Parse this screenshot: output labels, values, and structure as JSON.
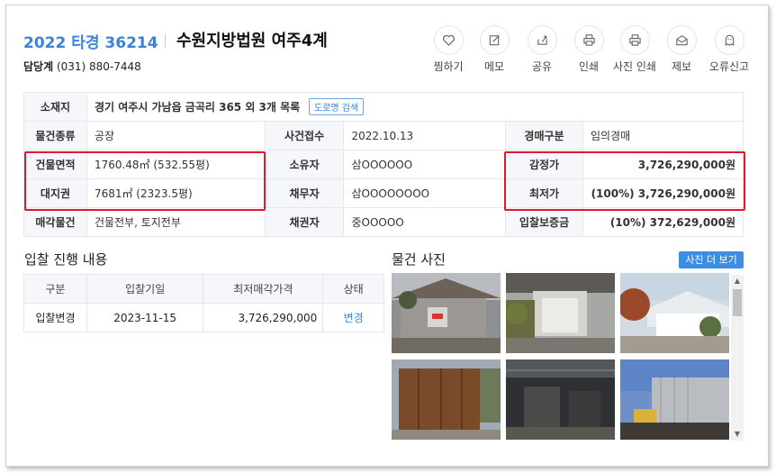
{
  "header": {
    "case_number": "2022 타경 36214",
    "court": "수원지방법원 여주4계",
    "manager_label": "담당계",
    "manager_phone": "(031) 880-7448"
  },
  "actions": [
    {
      "label": "찜하기",
      "icon": "heart-icon"
    },
    {
      "label": "메모",
      "icon": "memo-icon"
    },
    {
      "label": "공유",
      "icon": "share-icon"
    },
    {
      "label": "인쇄",
      "icon": "print-icon"
    },
    {
      "label": "사진 인쇄",
      "icon": "photo-print-icon"
    },
    {
      "label": "제보",
      "icon": "mail-icon"
    },
    {
      "label": "오류신고",
      "icon": "report-icon"
    }
  ],
  "info": {
    "location_label": "소재지",
    "location_value": "경기 여주시 가남읍 금곡리 365 외 3개 목록",
    "road_search": "도로명 검색",
    "type_label": "물건종류",
    "type_value": "공장",
    "received_label": "사건접수",
    "received_value": "2022.10.13",
    "auction_kind_label": "경매구분",
    "auction_kind_value": "임의경매",
    "building_area_label": "건물면적",
    "building_area_value": "1760.48㎡ (532.55평)",
    "owner_label": "소유자",
    "owner_value": "삼OOOOOO",
    "appraisal_label": "감정가",
    "appraisal_value": "3,726,290,000원",
    "land_right_label": "대지권",
    "land_right_value": "7681㎡ (2323.5평)",
    "debtor_label": "채무자",
    "debtor_value": "삼OOOOOOOO",
    "min_price_label": "최저가",
    "min_price_value": "(100%) 3,726,290,000원",
    "sale_item_label": "매각물건",
    "sale_item_value": "건물전부, 토지전부",
    "creditor_label": "채권자",
    "creditor_value": "중OOOOO",
    "deposit_label": "입찰보증금",
    "deposit_value": "(10%) 372,629,000원"
  },
  "bid_section": {
    "title": "입찰 진행 내용",
    "columns": [
      "구분",
      "입찰기일",
      "최저매각가격",
      "상태"
    ],
    "rows": [
      {
        "kind": "입찰변경",
        "date": "2023-11-15",
        "price": "3,726,290,000",
        "status": "변경"
      }
    ]
  },
  "photo_section": {
    "title": "물건 사진",
    "more_button": "사진 더 보기"
  },
  "colors": {
    "accent": "#3b82d8",
    "highlight_border": "#e0182a",
    "header_bg": "#f5f7fa"
  }
}
